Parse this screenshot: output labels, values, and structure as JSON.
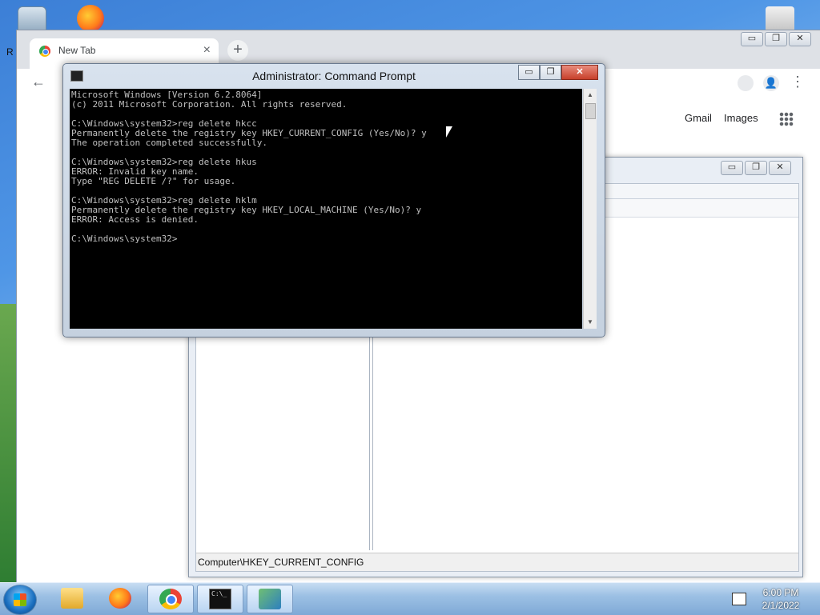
{
  "desktop": {
    "left_edge_label": "R"
  },
  "browser": {
    "tab": {
      "title": "New Tab",
      "close": "×"
    },
    "new_tab": "+",
    "window_buttons": {
      "minimize": "▭",
      "maximize": "❐",
      "close": "✕"
    },
    "back": "←",
    "kebab": "⋮",
    "person": "👤",
    "links": {
      "gmail": "Gmail",
      "images": "Images"
    }
  },
  "regedit": {
    "window_buttons": {
      "minimize": "▭",
      "maximize": "❐",
      "close": "✕"
    },
    "status": "Computer\\HKEY_CURRENT_CONFIG"
  },
  "cmd": {
    "title": "Administrator: Command Prompt",
    "buttons": {
      "minimize": "▭",
      "maximize": "❐",
      "close": "✕"
    },
    "output": "Microsoft Windows [Version 6.2.8064]\n(c) 2011 Microsoft Corporation. All rights reserved.\n\nC:\\Windows\\system32>reg delete hkcc\nPermanently delete the registry key HKEY_CURRENT_CONFIG (Yes/No)? y\nThe operation completed successfully.\n\nC:\\Windows\\system32>reg delete hkus\nERROR: Invalid key name.\nType \"REG DELETE /?\" for usage.\n\nC:\\Windows\\system32>reg delete hklm\nPermanently delete the registry key HKEY_LOCAL_MACHINE (Yes/No)? y\nERROR: Access is denied.\n\nC:\\Windows\\system32>",
    "scroll_up": "▲",
    "scroll_down": "▼"
  },
  "taskbar": {
    "cmd_icon_text": "C:\\_",
    "clock": {
      "time": "6:00 PM",
      "date": "2/1/2022"
    }
  }
}
